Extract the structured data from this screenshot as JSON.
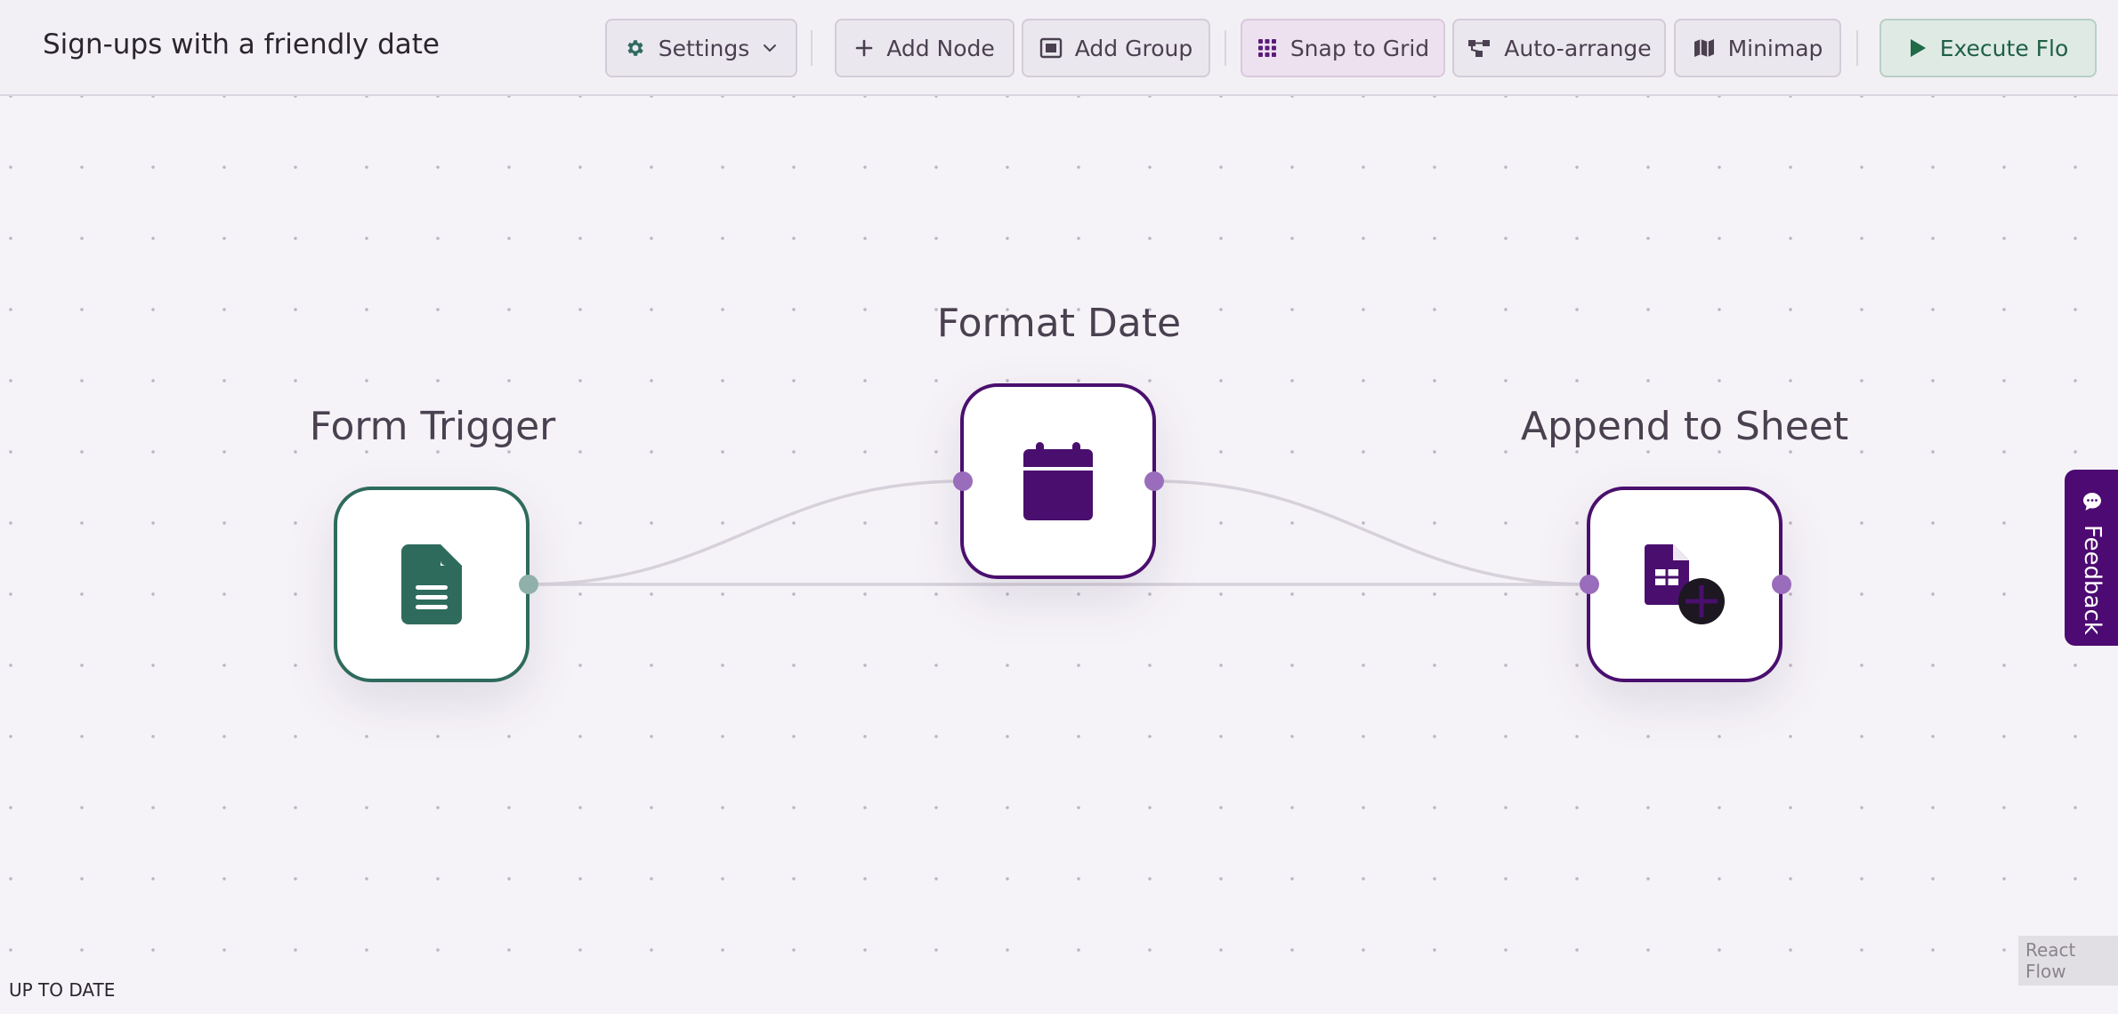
{
  "header": {
    "title": "Sign-ups with a friendly date",
    "toolbar": {
      "settings_label": "Settings",
      "add_node_label": "Add Node",
      "add_group_label": "Add Group",
      "snap_label": "Snap to Grid",
      "auto_arrange_label": "Auto-arrange",
      "minimap_label": "Minimap",
      "execute_label": "Execute Flo"
    }
  },
  "nodes": [
    {
      "label": "Form Trigger",
      "icon": "document-icon",
      "color": "#2e6b5d"
    },
    {
      "label": "Format Date",
      "icon": "calendar-icon",
      "color": "#4a0f6e"
    },
    {
      "label": "Append to Sheet",
      "icon": "sheet-add-icon",
      "color": "#4a0f6e"
    }
  ],
  "feedback": {
    "label": "Feedback"
  },
  "attribution": "React Flow",
  "status": "UP TO DATE",
  "colors": {
    "accent_purple": "#4a0f6e",
    "accent_green": "#2e6b5d",
    "handle_purple": "#9a6cbc",
    "handle_teal": "#8fb1a9"
  }
}
